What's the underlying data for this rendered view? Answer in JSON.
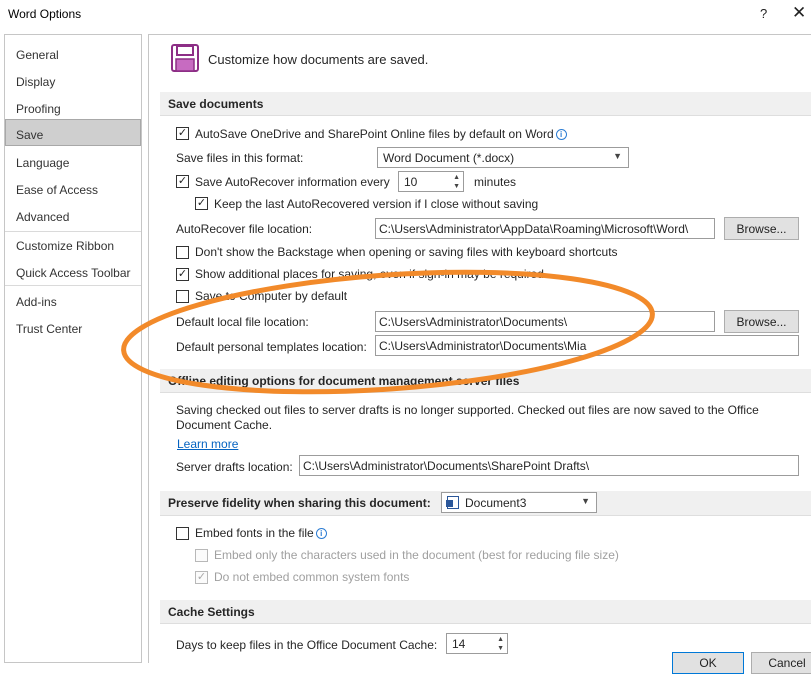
{
  "window": {
    "title": "Word Options",
    "help_glyph": "?",
    "close_glyph": "✕"
  },
  "sidebar": {
    "items": [
      {
        "label": "General"
      },
      {
        "label": "Display"
      },
      {
        "label": "Proofing"
      },
      {
        "label": "Save",
        "selected": true
      },
      {
        "label": "Language"
      },
      {
        "label": "Ease of Access"
      },
      {
        "label": "Advanced"
      },
      {
        "label": "Customize Ribbon"
      },
      {
        "label": "Quick Access Toolbar"
      },
      {
        "label": "Add-ins"
      },
      {
        "label": "Trust Center"
      }
    ]
  },
  "header": {
    "icon": "floppy-disk-icon",
    "text": "Customize how documents are saved."
  },
  "save_documents": {
    "title": "Save documents",
    "autosave": {
      "label": "AutoSave OneDrive and SharePoint Online files by default on Word",
      "checked": true
    },
    "format": {
      "label": "Save files in this format:",
      "value": "Word Document (*.docx)"
    },
    "autorecover": {
      "label": "Save AutoRecover information every",
      "checked": true,
      "value": "10",
      "unit": "minutes"
    },
    "keep_last": {
      "label": "Keep the last AutoRecovered version if I close without saving",
      "checked": true
    },
    "autorecover_location": {
      "label": "AutoRecover file location:",
      "value": "C:\\Users\\Administrator\\AppData\\Roaming\\Microsoft\\Word\\",
      "button": "Browse..."
    },
    "backstage": {
      "label": "Don't show the Backstage when opening or saving files with keyboard shortcuts",
      "checked": false
    },
    "additional_places": {
      "label": "Show additional places for saving, even if sign-in may be required.",
      "checked": true
    },
    "save_to_computer": {
      "label": "Save to Computer by default",
      "checked": false
    },
    "default_local": {
      "label": "Default local file location:",
      "value": "C:\\Users\\Administrator\\Documents\\",
      "button": "Browse..."
    },
    "templates": {
      "label": "Default personal templates location:",
      "value": "C:\\Users\\Administrator\\Documents\\Mia"
    }
  },
  "offline": {
    "title": "Offline editing options for document management server files",
    "notice_line1": "Saving checked out files to server drafts is no longer supported. Checked out files are now saved to the Office",
    "notice_line2": "Document Cache.",
    "learn_more": "Learn more",
    "drafts": {
      "label": "Server drafts location:",
      "value": "C:\\Users\\Administrator\\Documents\\SharePoint Drafts\\"
    }
  },
  "fidelity": {
    "title": "Preserve fidelity when sharing this document:",
    "document": "Document3",
    "embed_fonts": {
      "label": "Embed fonts in the file",
      "checked": false
    },
    "embed_only": {
      "label": "Embed only the characters used in the document (best for reducing file size)",
      "checked": false
    },
    "no_common": {
      "label": "Do not embed common system fonts",
      "checked": true
    }
  },
  "cache": {
    "title": "Cache Settings",
    "days": {
      "label": "Days to keep files in the Office Document Cache:",
      "value": "14"
    }
  },
  "footer": {
    "ok": "OK",
    "cancel": "Cancel"
  },
  "colors": {
    "highlight_ellipse": "#f28a2a",
    "link": "#0563c1",
    "selection": "#cfcfcf"
  }
}
